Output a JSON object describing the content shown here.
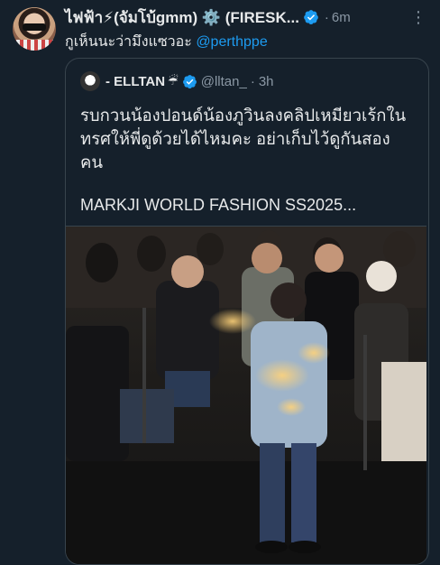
{
  "tweet": {
    "author_name": "ไฟฟ้า⚡(จัมโบ้gmm) ⚙️ (FIRESK...",
    "time": "6m",
    "more_icon": "more-icon",
    "text_main": "กูเห็นนะว่ามึงแซวอะ ",
    "mention": "@perthppe"
  },
  "quoted": {
    "author_name": "- ELLTAN",
    "author_emoji": "☔",
    "handle": "@lltan_",
    "time": "3h",
    "text_lines": [
      "รบกวนน้องปอนด์น้องภูวินลงคลิปเหมียวเร้กใน",
      "ทรศให้พี่ดูด้วยได้ไหมคะ อย่าเก็บไว้ดูกันสอง",
      "คน"
    ],
    "title": "MARKJI WORLD FASHION SS2025...",
    "media_icon": "photo-media"
  },
  "colors": {
    "background": "#15202b",
    "text": "#e7e9ea",
    "muted": "#8b98a5",
    "accent": "#1d9bf0",
    "border": "#38444d"
  }
}
